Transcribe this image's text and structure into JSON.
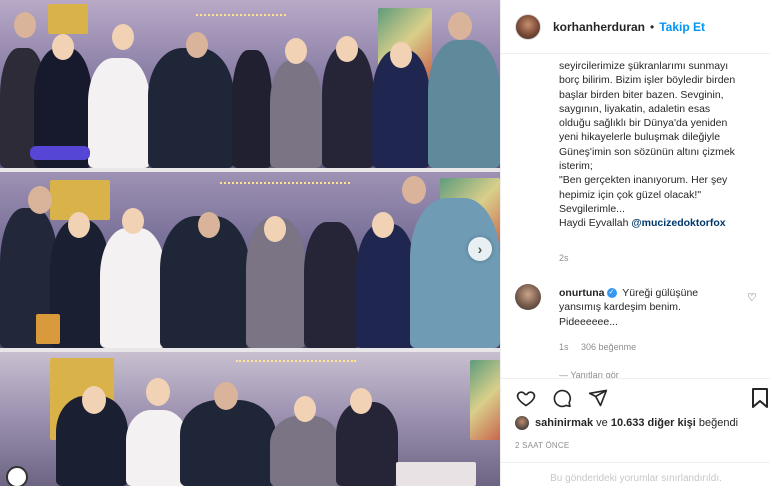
{
  "post": {
    "username": "korhanherduran",
    "follow_label": "Takip Et",
    "caption_lines": [
      "seyircilerimize şükranlarımı sunmayı",
      "borç bilirim. Bizim işler böyledir birden",
      "başlar birden biter bazen. Sevginin,",
      "saygının, liyakatin, adaletin esas",
      "olduğu sağlıklı bir Dünya'da yeniden",
      "yeni hikayelerle buluşmak dileğiyle",
      "Güneş'imin son sözünün altını çizmek",
      "isterim;",
      "\"Ben gerçekten inanıyorum. Her şey",
      "hepimiz için çok güzel olacak!\"",
      "Sevgilerimle..."
    ],
    "caption_last_prefix": "Haydi Eyvallah ",
    "caption_mention": "@mucizedoktorfox",
    "caption_time": "2s"
  },
  "comment": {
    "username": "onurtuna",
    "text_line1": " Yüreği gülüşüne",
    "text_line2": "yansımış kardeşim benim.",
    "text_line3": "Pideeeeee...",
    "time": "1s",
    "likes": "306 beğenme",
    "more_replies": "— Yanıtları gör"
  },
  "likes": {
    "user": "sahinirmak",
    "middle": " ve ",
    "count": "10.633 diğer kişi",
    "suffix": " beğendi"
  },
  "post_time": "2 SAAT ÖNCE",
  "comments_disabled": "Bu gönderideki yorumlar sınırlandırıldı.",
  "icons": {
    "like": "heart-icon",
    "comment": "comment-icon",
    "share": "share-icon",
    "save": "bookmark-icon",
    "next": "chevron-right-icon"
  },
  "colors": {
    "follow": "#0095f6",
    "mention": "#00376b",
    "muted": "#8e8e8e",
    "verified": "#3897f0"
  }
}
